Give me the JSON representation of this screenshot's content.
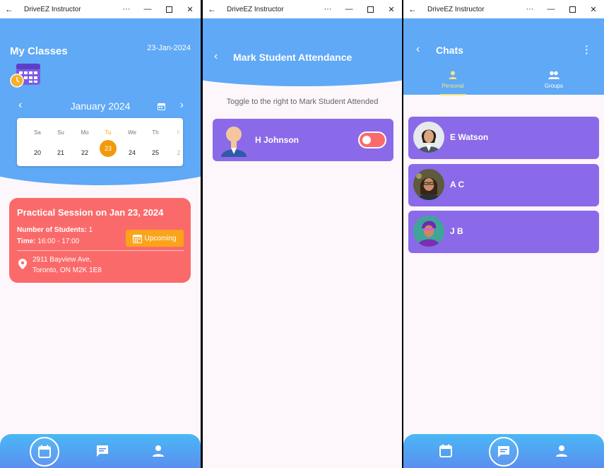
{
  "app": {
    "title": "DriveEZ Instructor"
  },
  "classes": {
    "title": "My Classes",
    "date": "23-Jan-2024",
    "month_label": "January 2024",
    "week": [
      {
        "day": "Sa",
        "date": "20"
      },
      {
        "day": "Su",
        "date": "21"
      },
      {
        "day": "Mo",
        "date": "22"
      },
      {
        "day": "Tu",
        "date": "23",
        "active": true
      },
      {
        "day": "We",
        "date": "24"
      },
      {
        "day": "Th",
        "date": "25"
      },
      {
        "day": "F",
        "date": "2"
      }
    ],
    "session": {
      "title": "Practical Session on Jan 23, 2024",
      "students_label": "Number of Students:",
      "students_value": "1",
      "time_label": "Time:",
      "time_value": "16:00 -  17:00",
      "status": "Upcoming",
      "address_line1": "2911 Bayview Ave,",
      "address_line2": "Toronto, ON M2K 1E8"
    }
  },
  "attendance": {
    "title": "Mark Student Attendance",
    "hint": "Toggle to the right to Mark Student Attended",
    "students": [
      {
        "name": "H Johnson",
        "attended": false
      }
    ]
  },
  "chats": {
    "title": "Chats",
    "tabs": [
      {
        "label": "Personal",
        "icon": "person-icon"
      },
      {
        "label": "Groups",
        "icon": "groups-icon"
      }
    ],
    "items": [
      {
        "name": "E Watson"
      },
      {
        "name": "A C"
      },
      {
        "name": "J B"
      }
    ]
  },
  "colors": {
    "header": "#5fa9f6",
    "card_purple": "#8a6ae8",
    "card_red": "#fb6a6a",
    "accent_orange": "#f39a0c",
    "tab_active": "#f7e37e"
  }
}
